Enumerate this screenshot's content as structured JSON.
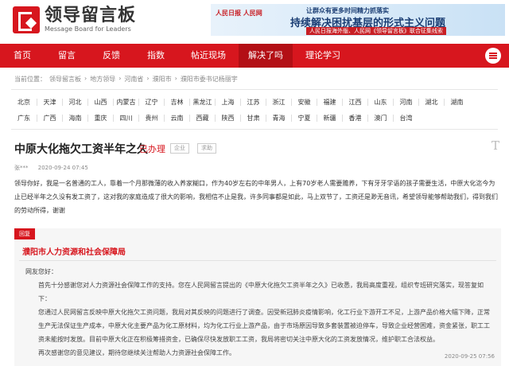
{
  "header": {
    "logo_cn": "领导留言板",
    "logo_en": "Message Board for Leaders",
    "banner": {
      "brand": "人民日报 人民网",
      "line1": "让群众有更多时间精力抓落实",
      "line2": "持续解决困扰基层的形式主义问题",
      "line3": "人民日报海外版、人民网《领导留言板》联合征集线索"
    }
  },
  "nav": {
    "items": [
      "首页",
      "留言",
      "反馈",
      "指数",
      "帖近现场",
      "解决了吗",
      "理论学习"
    ],
    "active_index": 5
  },
  "breadcrumb": {
    "label": "当前位置：",
    "items": [
      "领导留言板",
      "地方领导",
      "河南省",
      "濮阳市",
      "濮阳市委书记杨丽宇"
    ],
    "separator": "›"
  },
  "provinces": {
    "row1": [
      "北京",
      "天津",
      "河北",
      "山西",
      "内蒙古",
      "辽宁",
      "吉林",
      "黑龙江",
      "上海",
      "江苏",
      "浙江",
      "安徽",
      "福建",
      "江西",
      "山东",
      "河南",
      "湖北",
      "湖南"
    ],
    "row2": [
      "广东",
      "广西",
      "海南",
      "重庆",
      "四川",
      "贵州",
      "云南",
      "西藏",
      "陕西",
      "甘肃",
      "青海",
      "宁夏",
      "新疆",
      "香港",
      "澳门",
      "台湾"
    ]
  },
  "message": {
    "title": "中原大化拖欠工资半年之久",
    "status": "已办理",
    "tags": [
      "企业",
      "求助"
    ],
    "font_toggle": "T",
    "author": "张***",
    "date": "2020-09-24 07:45",
    "body": "领导你好，我是一名普通的工人，靠着一个月那微薄的收入养家糊口，作为40岁左右的中年男人，上有70岁老人需要赡养，下有牙牙学语的孩子需要生活，中原大化迄今为止已经半年之久没有发工资了，这对我的家庭造成了很大的影响，我相信不止是我，许多同事都是如此，马上双节了，工资还是渺无音讯，希望领导能够帮助我们，得到我们的劳动所得，谢谢"
  },
  "reply": {
    "tag": "回复",
    "org": "濮阳市人力资源和社会保障局",
    "greeting": "网友您好：",
    "p1": "首先十分感谢您对人力资源社会保障工作的支持。您在人民网留言提出的《中原大化拖欠工资半年之久》已收悉，我局高度重视，组织专班研究落实，现答复如下：",
    "p2": "您通过人民网留言反映中原大化拖欠工资问题，我局对其反映的问题进行了调查。因受新冠肺炎疫情影响，化工行业下游开工不足，上游产品价格大幅下降，正常生产无法保证生产成本，中原大化主要产品为化工原材料，均为化工行业上游产品，由于市场原因导致多套装置被迫停车，导致企业经营困难，资金紧张，职工工资未能按时发放。目前中原大化正在积极筹措资金，已确保尽快发放职工工资，我局将密切关注中原大化的工资发放情况，维护职工合法权益。",
    "p3": "再次感谢您的意见建议，期待您继续关注帮助人力资源社会保障工作。",
    "date": "2020-09-25 07:56"
  }
}
